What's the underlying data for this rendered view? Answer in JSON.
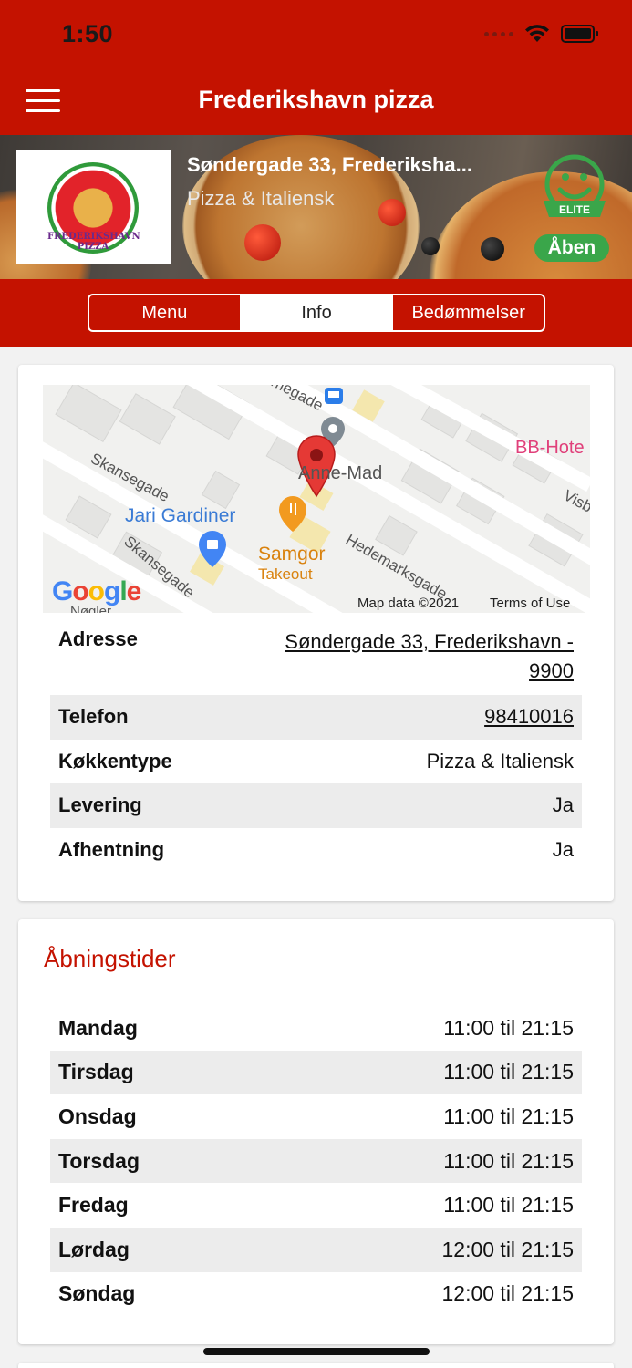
{
  "status_bar": {
    "time": "1:50"
  },
  "navbar": {
    "title": "Frederikshavn pizza"
  },
  "banner": {
    "logo_text": "FREDERIKSHAVN PIZZA",
    "address": "Søndergade 33, Frederiksha...",
    "cuisine": "Pizza & Italiensk",
    "badge_text": "ELITE",
    "open_status": "Åben"
  },
  "tabs": [
    {
      "label": "Menu",
      "active": false
    },
    {
      "label": "Info",
      "active": true
    },
    {
      "label": "Bedømmelser",
      "active": false
    }
  ],
  "map": {
    "labels": {
      "street1": "Skansegade",
      "street2": "Skansegade",
      "street3": "Hedemarksgade",
      "street4": "megade",
      "street5": "Visb",
      "poi1": "Jari Gardiner",
      "poi2": "Samgor",
      "poi2_sub": "Takeout",
      "poi3": "BB-Hote",
      "poi4": "Anne-Mad",
      "poi5": "Nøgler"
    },
    "google_logo": "Google",
    "map_data": "Map data ©2021",
    "terms": "Terms of Use"
  },
  "info": {
    "address_label": "Adresse",
    "address_line1": "Søndergade 33, Frederikshavn -",
    "address_line2": "9900",
    "phone_label": "Telefon",
    "phone_value": "98410016",
    "cuisine_label": "Køkkentype",
    "cuisine_value": "Pizza & Italiensk",
    "delivery_label": "Levering",
    "delivery_value": "Ja",
    "pickup_label": "Afhentning",
    "pickup_value": "Ja"
  },
  "hours": {
    "title": "Åbningstider",
    "days": [
      {
        "day": "Mandag",
        "time": "11:00 til 21:15"
      },
      {
        "day": "Tirsdag",
        "time": "11:00 til 21:15"
      },
      {
        "day": "Onsdag",
        "time": "11:00 til 21:15"
      },
      {
        "day": "Torsdag",
        "time": "11:00 til 21:15"
      },
      {
        "day": "Fredag",
        "time": "11:00 til 21:15"
      },
      {
        "day": "Lørdag",
        "time": "12:00 til 21:15"
      },
      {
        "day": "Søndag",
        "time": "12:00 til 21:15"
      }
    ]
  },
  "colors": {
    "brand_red": "#c41200",
    "open_green": "#3aa64a",
    "link_red": "#c41200"
  }
}
